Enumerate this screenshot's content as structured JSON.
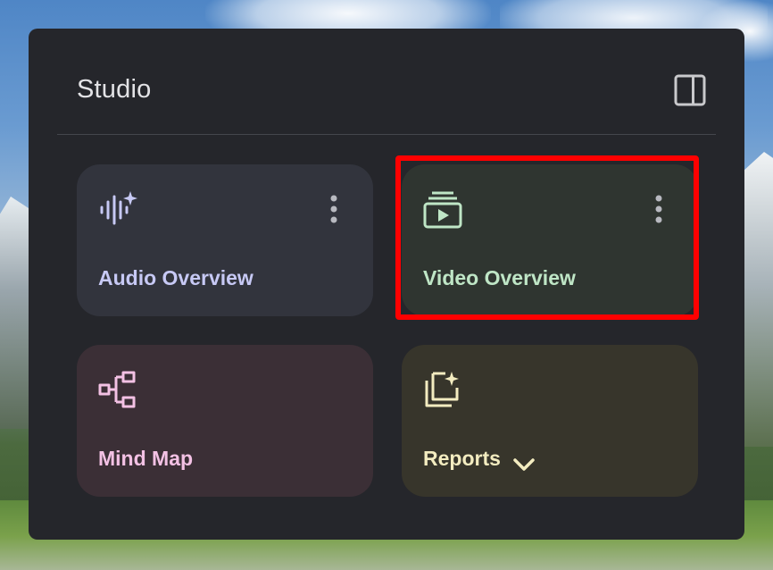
{
  "studio": {
    "title": "Studio",
    "toggle_icon": "panel-toggle-icon"
  },
  "cards": {
    "audio": {
      "label": "Audio Overview",
      "icon": "audio-waveform-sparkle-icon",
      "color": "#c7c9f5"
    },
    "video": {
      "label": "Video Overview",
      "icon": "video-play-stack-icon",
      "color": "#bfe6c6"
    },
    "mindmap": {
      "label": "Mind Map",
      "icon": "mind-map-icon",
      "color": "#f3c1e4"
    },
    "reports": {
      "label": "Reports",
      "icon": "reports-sparkle-icon",
      "color": "#f3ecc0"
    }
  },
  "colors": {
    "panel_bg": "#25262b",
    "highlight": "#ff0000"
  }
}
